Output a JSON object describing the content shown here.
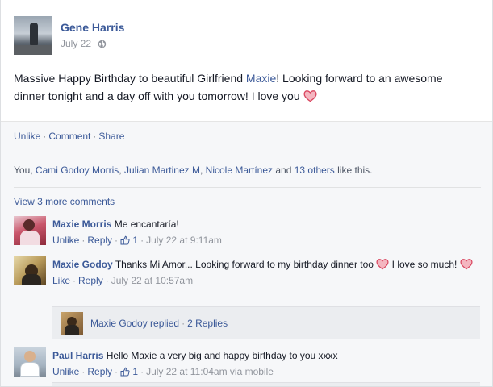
{
  "post": {
    "author": "Gene Harris",
    "date": "July 22",
    "text_before": "Massive Happy Birthday to beautiful Girlfriend ",
    "mention": "Maxie",
    "text_after": "! Looking forward to an awesome dinner tonight and a day off with you tomorrow! I love you"
  },
  "actions": {
    "unlike": "Unlike",
    "comment": "Comment",
    "share": "Share"
  },
  "likes": {
    "you": "You",
    "names": [
      "Cami Godoy Morris",
      "Julian Martinez M",
      "Nicole Martínez"
    ],
    "and": "and",
    "others": "13 others",
    "suffix": "like this."
  },
  "view_more": "View 3 more comments",
  "comments": [
    {
      "author": "Maxie Morris",
      "text": "Me encantaría!",
      "like_label": "Unlike",
      "reply_label": "Reply",
      "like_count": "1",
      "time": "July 22 at 9:11am"
    },
    {
      "author": "Maxie Godoy",
      "text_part1": "Thanks Mi Amor... Looking forward to my birthday dinner too",
      "text_part2": "I love so much!",
      "like_label": "Like",
      "reply_label": "Reply",
      "time": "July 22 at 10:57am"
    },
    {
      "author": "Paul Harris",
      "text": "Hello Maxie a very big and happy birthday to you xxxx",
      "like_label": "Unlike",
      "reply_label": "Reply",
      "like_count": "1",
      "time": "July 22 at 11:04am via mobile"
    }
  ],
  "replies": {
    "author": "Maxie Godoy",
    "verb": "replied",
    "count": "2 Replies"
  },
  "colors": {
    "link": "#3b5998",
    "heart": "#e0566e",
    "panel": "#f6f7f9"
  }
}
